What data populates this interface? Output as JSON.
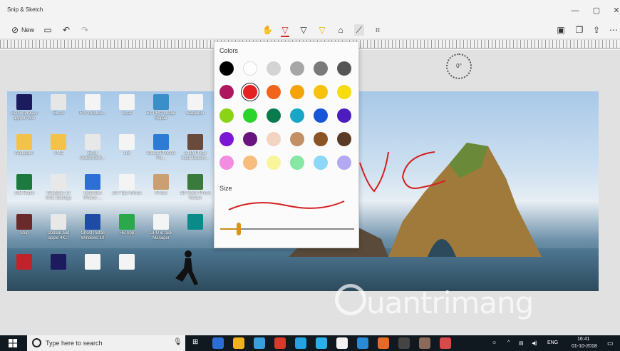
{
  "window": {
    "title": "Snip & Sketch",
    "controls": {
      "minimize": "—",
      "maximize": "▢",
      "close": "✕"
    }
  },
  "toolbar": {
    "new_label": "New",
    "icons": [
      "new-snip-icon",
      "open-icon",
      "undo-icon",
      "redo-icon",
      "touch-writing-icon",
      "ballpoint-pen-icon",
      "pencil-icon",
      "highlighter-icon",
      "eraser-icon",
      "ruler-icon",
      "crop-icon",
      "save-icon",
      "copy-icon",
      "share-icon",
      "more-icon"
    ],
    "pen_colors": [
      "#e32222",
      "#444444",
      "#f0c419"
    ]
  },
  "protractor": {
    "angle_label": "0°"
  },
  "colors_popup": {
    "heading": "Colors",
    "size_heading": "Size",
    "selected_index": 7,
    "swatches": [
      "#000000",
      "#ffffff",
      "#d4d4d4",
      "#a6a6a6",
      "#7a7a7a",
      "#555555",
      "#b0155f",
      "#e32222",
      "#f26419",
      "#f5a30a",
      "#f8c10e",
      "#f7dc0f",
      "#8cd315",
      "#2ad42a",
      "#0a7b4d",
      "#17a6c6",
      "#1656d6",
      "#4c1cbd",
      "#7b16d6",
      "#6a157f",
      "#f3d3c2",
      "#c39066",
      "#8b5426",
      "#5a3a24",
      "#f28de0",
      "#f7bd7c",
      "#f9f59a",
      "#86e8a3",
      "#8dd8f7",
      "#b3a8f2"
    ],
    "size_level": 0.14
  },
  "desktop_icons": [
    {
      "label": "Screenpresso app on Win",
      "color": "#1b1b5e"
    },
    {
      "label": "Excel",
      "color": "#e6e6e6"
    },
    {
      "label": "FIX Window...",
      "color": "#f4f4f4"
    },
    {
      "label": "vista",
      "color": "#f4f4f4"
    },
    {
      "label": "5X PRO Image Repair",
      "color": "#3a8fc9"
    },
    {
      "label": "wallpaper",
      "color": "#f4f4f4"
    },
    {
      "label": "Wallpaper",
      "color": "#f2c24b"
    },
    {
      "label": "VMC",
      "color": "#f2c24b"
    },
    {
      "label": "Error 0x8024000...",
      "color": "#e8e8e8"
    },
    {
      "label": "OS",
      "color": "#f4f4f4"
    },
    {
      "label": "Stellar Phoenix Ph...",
      "color": "#2e7bd6"
    },
    {
      "label": "a.tab Photo Scan Docum...",
      "color": "#6a4a3a"
    },
    {
      "label": "10E Radio",
      "color": "#1d7a3e"
    },
    {
      "label": "Windows 10 UAC Settings",
      "color": "#e8e8e8"
    },
    {
      "label": "DearMob iPhone ...",
      "color": "#2d6fd6"
    },
    {
      "label": "100 Tips Words",
      "color": "#f4f4f4"
    },
    {
      "label": "IPhoto",
      "color": "#caa072"
    },
    {
      "label": "3D Vision Photo Viewer",
      "color": "#3a7a3a"
    },
    {
      "label": "Snip",
      "color": "#6a2a2a"
    },
    {
      "label": "Update and apple 4K...",
      "color": "#e8e8e8"
    },
    {
      "label": "Ghost Install Windows 10",
      "color": "#1e4ba6"
    },
    {
      "label": "HB App",
      "color": "#2aa84a"
    },
    {
      "label": "GPU in task Manager",
      "color": "#f4f4f4"
    },
    {
      "label": "",
      "color": "#0b8a8a"
    },
    {
      "label": "",
      "color": "#c0242a"
    },
    {
      "label": "",
      "color": "#1b1b5e"
    },
    {
      "label": "",
      "color": "#f4f4f4"
    },
    {
      "label": "",
      "color": "#f4f4f4"
    }
  ],
  "watermark": {
    "text": "uantrimang"
  },
  "taskbar": {
    "search_placeholder": "Type here to search",
    "language": "ENG",
    "time": "16:41",
    "date": "01-10-2018",
    "apps": [
      "#2b6fd6",
      "#f2b01e",
      "#39a0e0",
      "#d63a2a",
      "#25a2e0",
      "#2ab0e8",
      "#f2f2f2",
      "#2a8ad6",
      "#e86a2a",
      "#444444",
      "#8a6a5a",
      "#d64a4a"
    ]
  }
}
